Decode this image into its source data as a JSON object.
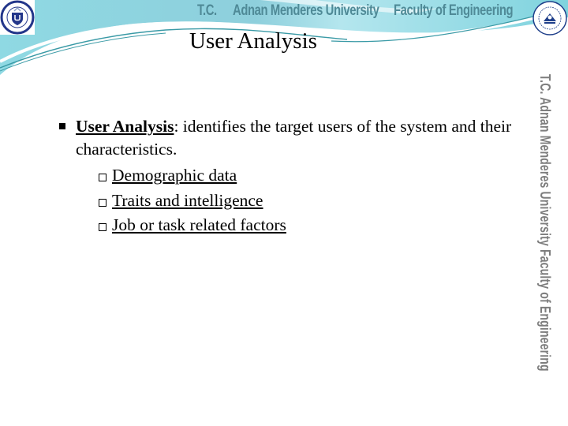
{
  "header": {
    "tc": "T.C.",
    "university": "Adnan Menderes University",
    "faculty": "Faculty of Engineering",
    "side_text": "T.C.   Adnan Menderes University   Faculty of Engineering",
    "colors": {
      "banner_light": "#c9eef2",
      "banner_mid": "#7fd3de",
      "banner_dark": "#3a9aa6",
      "header_text": "#4f8a97",
      "side_text": "#7d7d7d"
    }
  },
  "logos": {
    "left": "university-seal-icon",
    "right": "engineering-faculty-seal-icon"
  },
  "slide": {
    "title": "User Analysis",
    "bullet": {
      "term": "User Analysis",
      "text": ": identifies the target users of the system and their characteristics."
    },
    "sub_items": [
      {
        "label": "Demographic data"
      },
      {
        "label": "Traits and intelligence"
      },
      {
        "label": "Job or task related factors"
      }
    ]
  }
}
